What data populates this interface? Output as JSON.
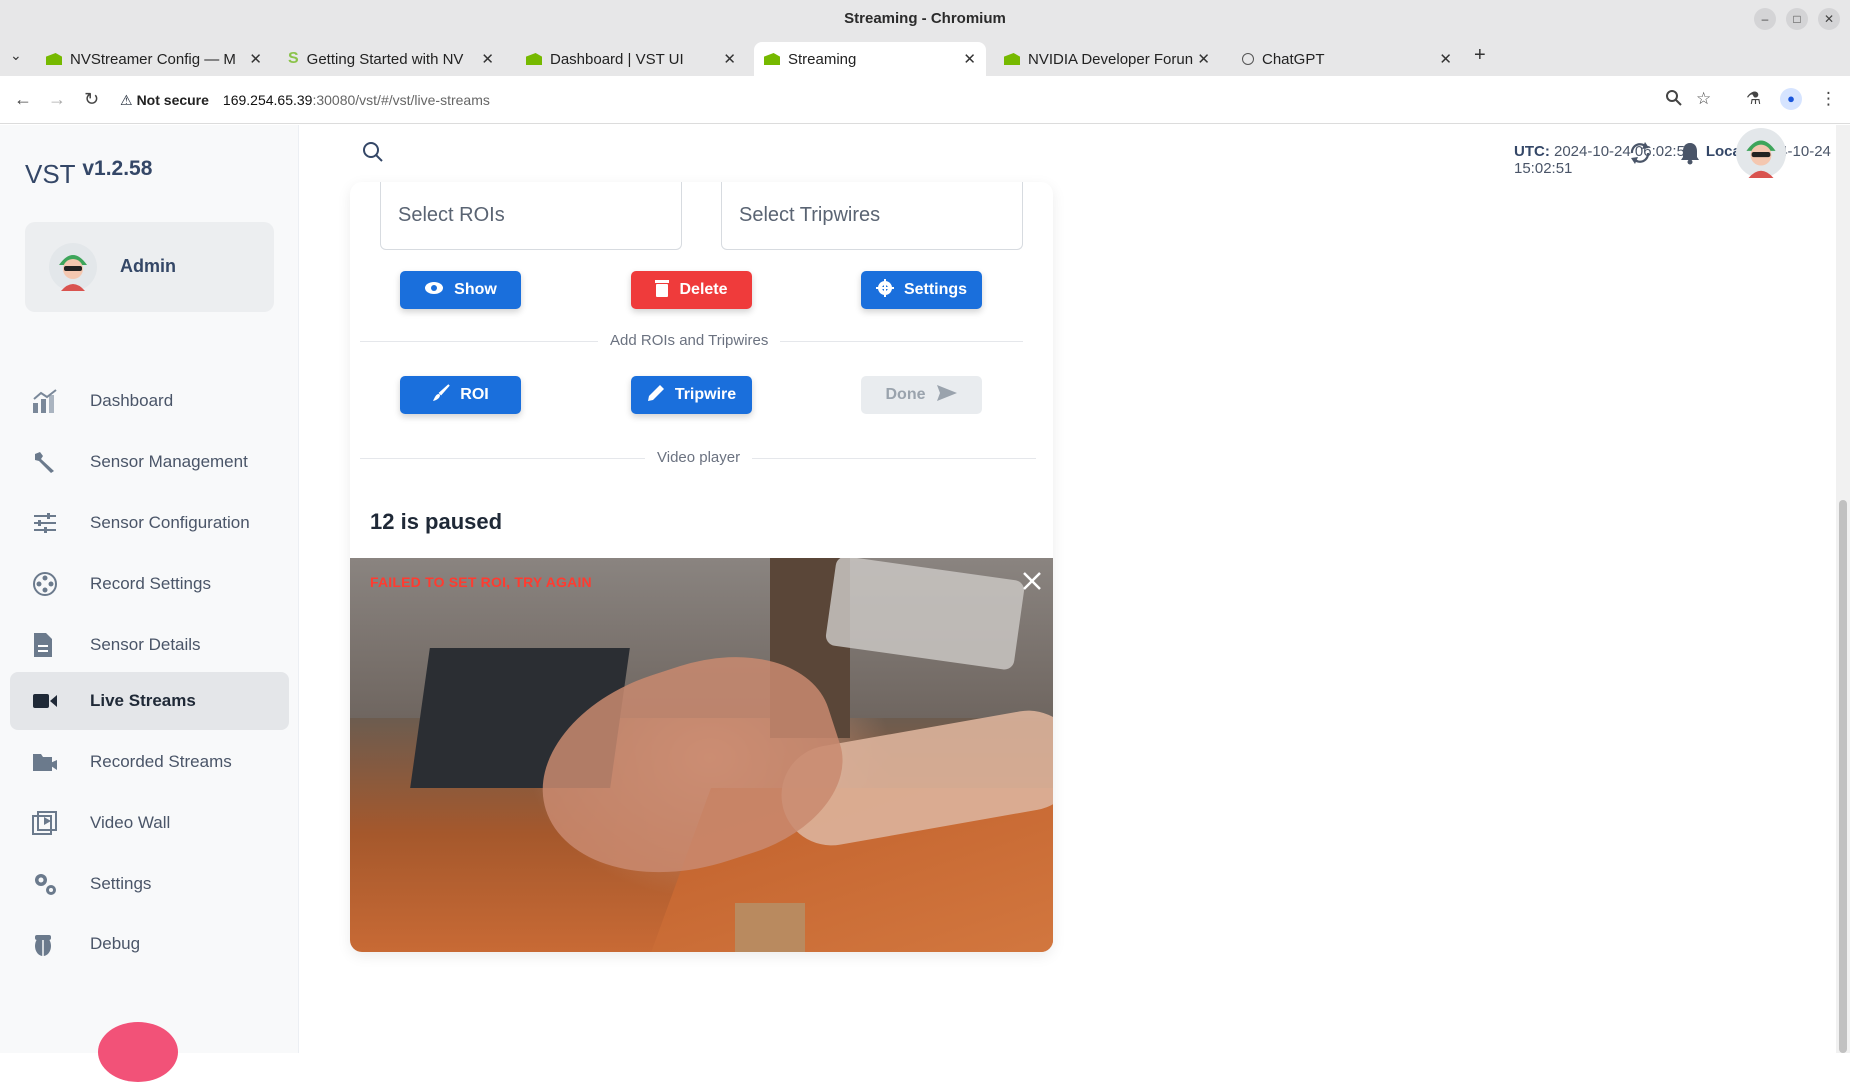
{
  "window": {
    "title": "Streaming - Chromium"
  },
  "tabs": [
    {
      "label": "NVStreamer Config — M",
      "favicon": "nvidia-icon"
    },
    {
      "label": "Getting Started with NV",
      "favicon": "s-icon"
    },
    {
      "label": "Dashboard | VST UI",
      "favicon": "nvidia-icon"
    },
    {
      "label": "Streaming",
      "favicon": "nvidia-icon",
      "active": true
    },
    {
      "label": "NVIDIA Developer Forun",
      "favicon": "nvidia-icon"
    },
    {
      "label": "ChatGPT",
      "favicon": "chatgpt-icon"
    }
  ],
  "address_bar": {
    "security_label": "Not secure",
    "url_host": "169.254.65.39",
    "url_rest": ":30080/vst/#/vst/live-streams"
  },
  "app": {
    "brand": "VST",
    "version": "v1.2.58",
    "user": {
      "name": "Admin"
    }
  },
  "sidebar": {
    "items": [
      {
        "label": "Dashboard",
        "icon": "chart-icon"
      },
      {
        "label": "Sensor Management",
        "icon": "wrench-icon"
      },
      {
        "label": "Sensor Configuration",
        "icon": "sliders-icon"
      },
      {
        "label": "Record Settings",
        "icon": "film-reel-icon"
      },
      {
        "label": "Sensor Details",
        "icon": "document-icon"
      },
      {
        "label": "Live Streams",
        "icon": "video-camera-icon",
        "active": true
      },
      {
        "label": "Recorded Streams",
        "icon": "folder-video-icon"
      },
      {
        "label": "Video Wall",
        "icon": "play-stack-icon"
      },
      {
        "label": "Settings",
        "icon": "gears-icon"
      },
      {
        "label": "Debug",
        "icon": "bug-icon"
      }
    ]
  },
  "header": {
    "utc_label": "UTC:",
    "utc_value": "2024-10-24 06:02:51",
    "local_label": "Local:",
    "local_value": "2024-10-24 15:02:51"
  },
  "roi_panel": {
    "select_rois_placeholder": "Select ROIs",
    "select_tripwires_placeholder": "Select Tripwires",
    "show_label": "Show",
    "delete_label": "Delete",
    "settings_label": "Settings",
    "add_section_label": "Add ROIs and Tripwires",
    "roi_label": "ROI",
    "tripwire_label": "Tripwire",
    "done_label": "Done",
    "video_section_label": "Video player"
  },
  "player": {
    "status": "12 is paused",
    "error_message": "FAILED TO SET ROI, TRY AGAIN"
  },
  "colors": {
    "primary": "#1a6fdc",
    "danger": "#ef3b3b",
    "error_text": "#ff3b30",
    "disabled": "#e9ecef"
  }
}
